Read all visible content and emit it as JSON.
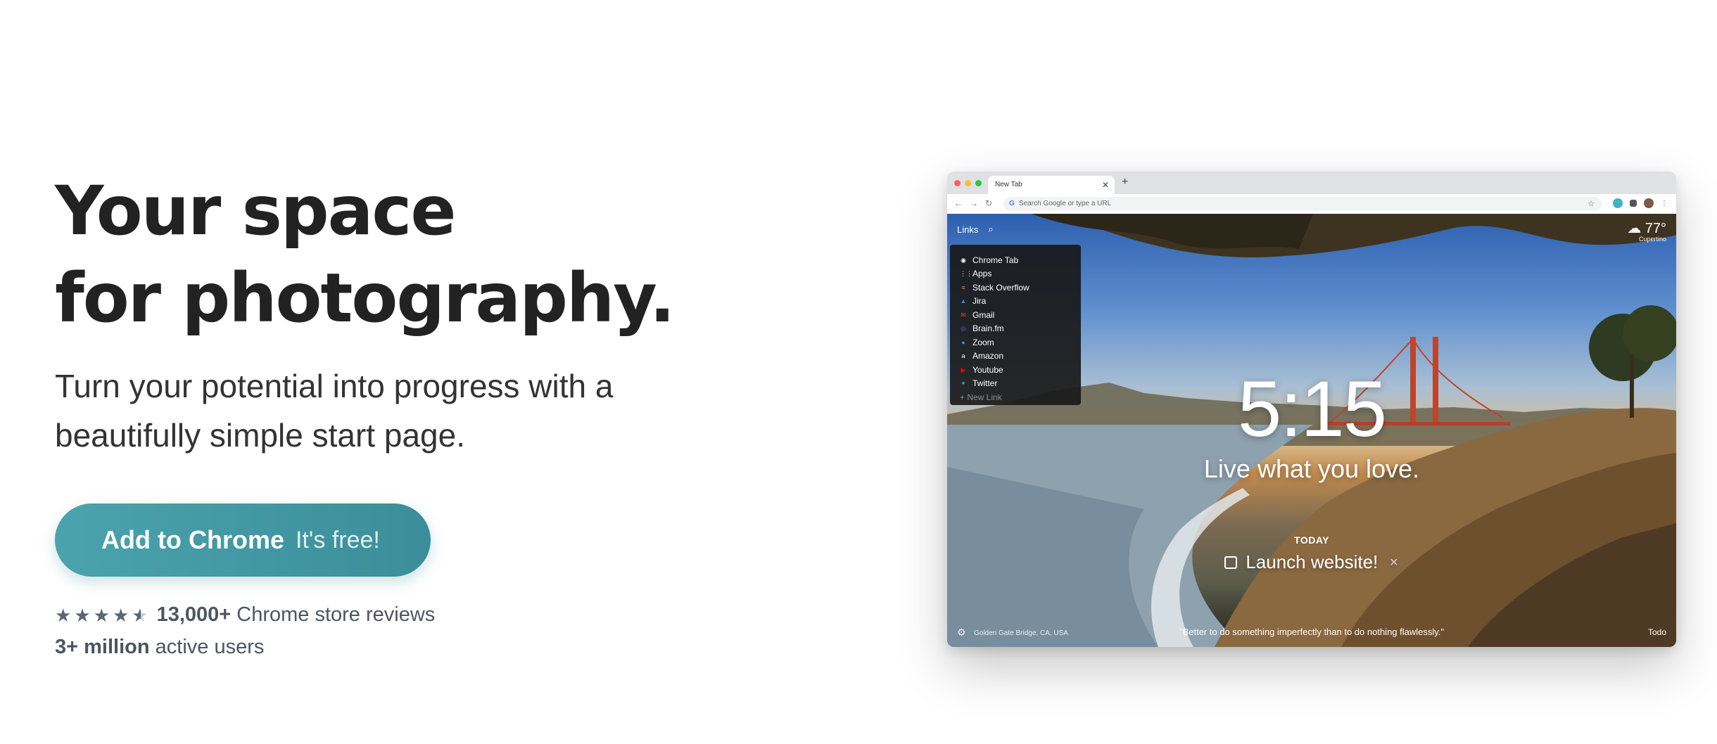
{
  "hero": {
    "headline_line1": "Your space",
    "headline_line2": "for photography.",
    "subhead": "Turn your potential into progress with a beautifully simple start page.",
    "cta_main": "Add to Chrome",
    "cta_free": "It's free!",
    "rating_value": 4.5,
    "reviews_count": "13,000+",
    "reviews_label": "Chrome store reviews",
    "users_count": "3+ million",
    "users_label": "active users"
  },
  "browser": {
    "tab_title": "New Tab",
    "omnibox_placeholder": "Search Google or type a URL",
    "links_label": "Links",
    "links": [
      {
        "label": "Chrome Tab",
        "icon": "chrome-icon"
      },
      {
        "label": "Apps",
        "icon": "apps-grid-icon"
      },
      {
        "label": "Stack Overflow",
        "icon": "stack-overflow-icon"
      },
      {
        "label": "Jira",
        "icon": "jira-icon"
      },
      {
        "label": "Gmail",
        "icon": "gmail-icon"
      },
      {
        "label": "Brain.fm",
        "icon": "brainfm-icon"
      },
      {
        "label": "Zoom",
        "icon": "zoom-icon"
      },
      {
        "label": "Amazon",
        "icon": "amazon-icon"
      },
      {
        "label": "Youtube",
        "icon": "youtube-icon"
      },
      {
        "label": "Twitter",
        "icon": "twitter-icon"
      }
    ],
    "new_link_label": "+ New Link",
    "weather_temp": "77°",
    "weather_location": "Cupertino",
    "time": "5:15",
    "mantra": "Live what you love.",
    "today_label": "TODAY",
    "todo_text": "Launch website!",
    "photo_credit": "Golden Gate Bridge, CA, USA",
    "quote": "\"Better to do something imperfectly than to do nothing flawlessly.\"",
    "todo_link": "Todo"
  },
  "colors": {
    "cta_start": "#4aa3ad",
    "cta_end": "#3b8e99",
    "headline": "#222222",
    "muted_text": "#4b565f"
  }
}
